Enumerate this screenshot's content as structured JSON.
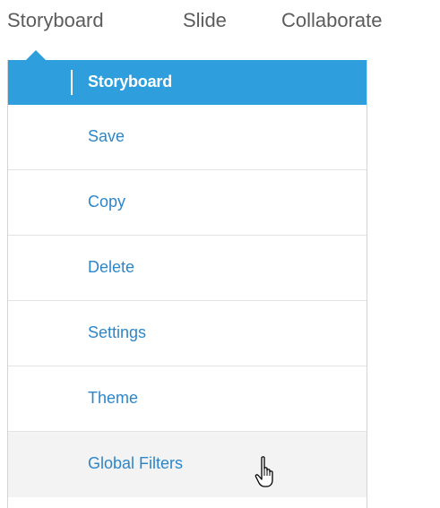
{
  "nav": {
    "tabs": [
      {
        "label": "Storyboard"
      },
      {
        "label": "Slide"
      },
      {
        "label": "Collaborate"
      }
    ],
    "active_tab": "Storyboard"
  },
  "menu": {
    "header": "Storyboard",
    "items": [
      {
        "label": "Save"
      },
      {
        "label": "Copy"
      },
      {
        "label": "Delete"
      },
      {
        "label": "Settings"
      },
      {
        "label": "Theme"
      },
      {
        "label": "Global Filters"
      }
    ],
    "hovered_item": "Global Filters"
  },
  "colors": {
    "accent": "#2e9fdc",
    "link": "#2e86c9",
    "tab_text": "#5c5c5c",
    "hover_bg": "#f3f3f3"
  },
  "icons": {
    "pointer": "hand-pointer-icon"
  }
}
